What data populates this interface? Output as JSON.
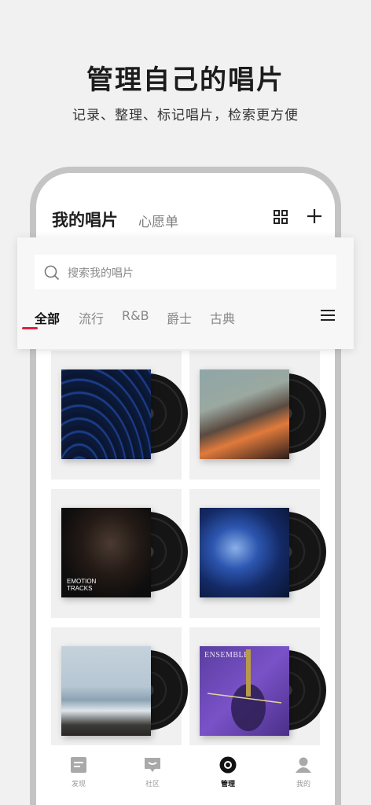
{
  "hero": {
    "title": "管理自己的唱片",
    "subtitle": "记录、整理、标记唱片，检索更方便"
  },
  "header": {
    "tabs": [
      "我的唱片",
      "心愿单"
    ],
    "grid_icon": "grid-icon",
    "add_icon": "plus-icon"
  },
  "search": {
    "placeholder": "搜索我的唱片",
    "icon": "search-icon"
  },
  "categories": [
    "全部",
    "流行",
    "R&B",
    "爵士",
    "古典"
  ],
  "accent_color": "#e0223a",
  "albums": [
    {
      "cover_text": ""
    },
    {
      "cover_text": ""
    },
    {
      "cover_text": "EMOTION\nTRACKS"
    },
    {
      "cover_text": ""
    },
    {
      "cover_text": ""
    },
    {
      "cover_text": "ENSEMBLE"
    }
  ],
  "nav": [
    {
      "label": "发现",
      "icon": "discover-icon"
    },
    {
      "label": "社区",
      "icon": "community-icon"
    },
    {
      "label": "管理",
      "icon": "record-icon"
    },
    {
      "label": "我的",
      "icon": "profile-icon"
    }
  ],
  "nav_active": "管理"
}
